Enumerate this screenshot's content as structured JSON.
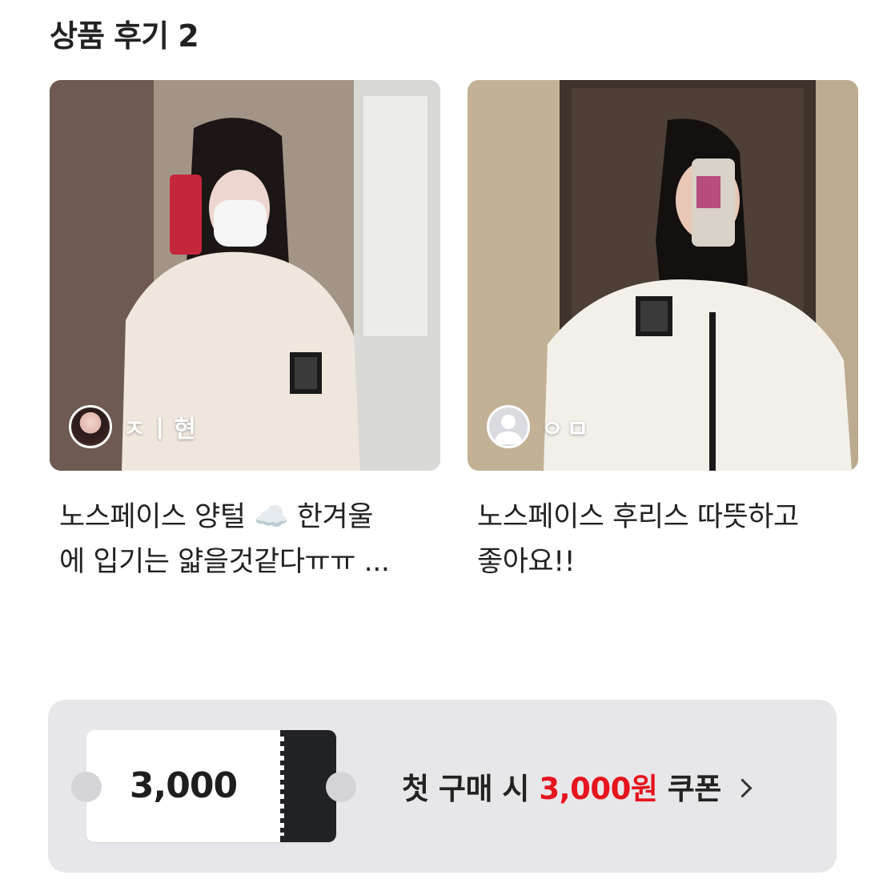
{
  "section": {
    "title": "상품 후기 2"
  },
  "reviews": [
    {
      "author": "ㅈㅣ현",
      "avatar_icon": "profile-photo",
      "caption_line1": "노스페이스 양털 ☁️ 한겨울",
      "caption_line2": "에 입기는 얇을것같다ㅠㅠ ..."
    },
    {
      "author": "ㅇㅁ",
      "avatar_icon": "default-user-icon",
      "caption_line1": "노스페이스 후리스 따뜻하고",
      "caption_line2": "좋아요!!"
    }
  ],
  "coupon": {
    "ticket_amount": "3,000",
    "text_prefix": "첫 구매 시 ",
    "text_amount": "3,000원",
    "text_suffix": " 쿠폰",
    "accent_color": "#e6141e",
    "chevron_icon": "chevron-right-icon"
  }
}
